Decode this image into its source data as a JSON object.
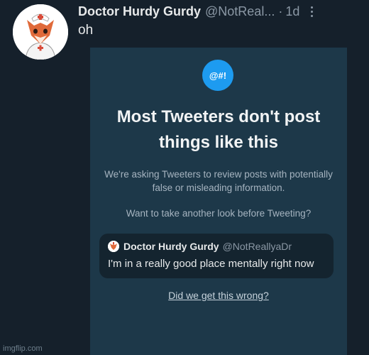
{
  "tweet": {
    "author_name": "Doctor Hurdy Gurdy",
    "author_handle": "@NotReal...",
    "separator": "·",
    "age": "1d",
    "text": "oh"
  },
  "prompt_card": {
    "badge_text": "@#!",
    "title": "Most Tweeters don't post things like this",
    "body": "We're asking Tweeters to review posts with potentially false or misleading information.",
    "question": "Want to take another look before Tweeting?",
    "quoted_tweet": {
      "author_name": "Doctor Hurdy Gurdy",
      "author_handle": "@NotReallyaDr",
      "text": "I'm in a really good place mentally right now"
    },
    "feedback_link": "Did we get this wrong?"
  },
  "watermark": "imgflip.com",
  "colors": {
    "background": "#15202b",
    "card": "#1d3849",
    "accent": "#1d9bf0"
  },
  "icons": {
    "avatar": "fox-nurse-avatar",
    "more": "more-vertical-icon"
  }
}
